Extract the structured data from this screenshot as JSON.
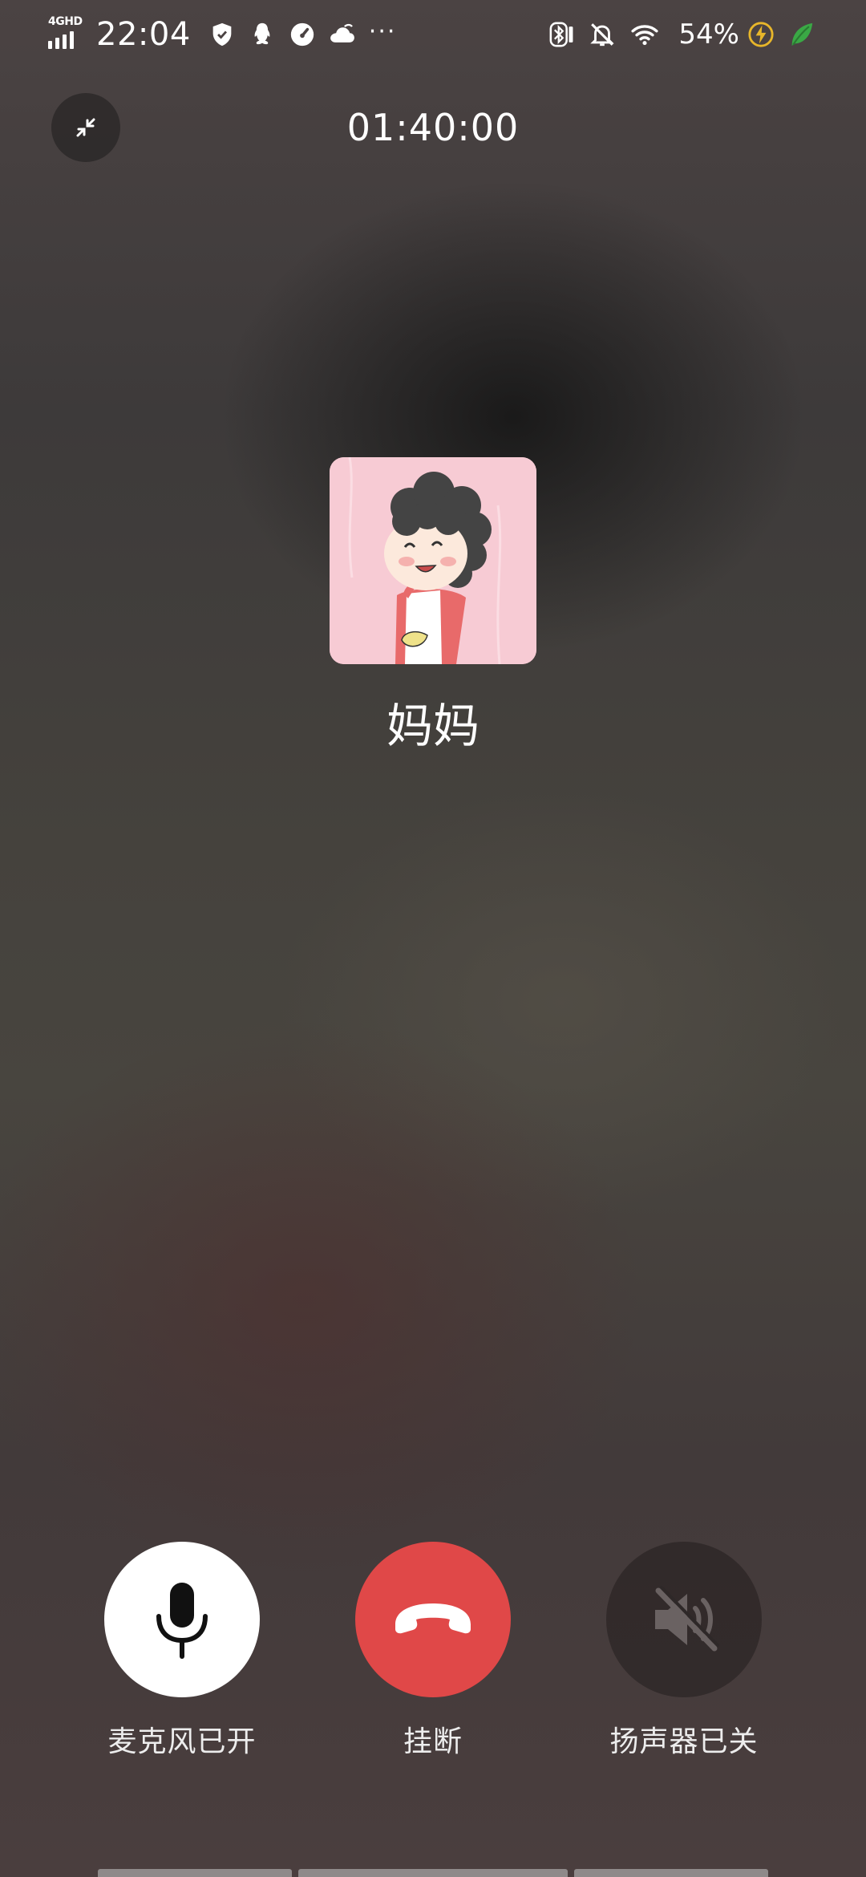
{
  "status_bar": {
    "network_label": "4GHD",
    "time": "22:04",
    "more": "···",
    "battery": "54%"
  },
  "call": {
    "timer": "01:40:00",
    "contact_name": "妈妈"
  },
  "controls": {
    "mic_label": "麦克风已开",
    "hangup_label": "挂断",
    "speaker_label": "扬声器已关"
  },
  "colors": {
    "hangup": "#e04848",
    "mic_bg": "#ffffff",
    "speaker_bg": "#2e2828"
  }
}
